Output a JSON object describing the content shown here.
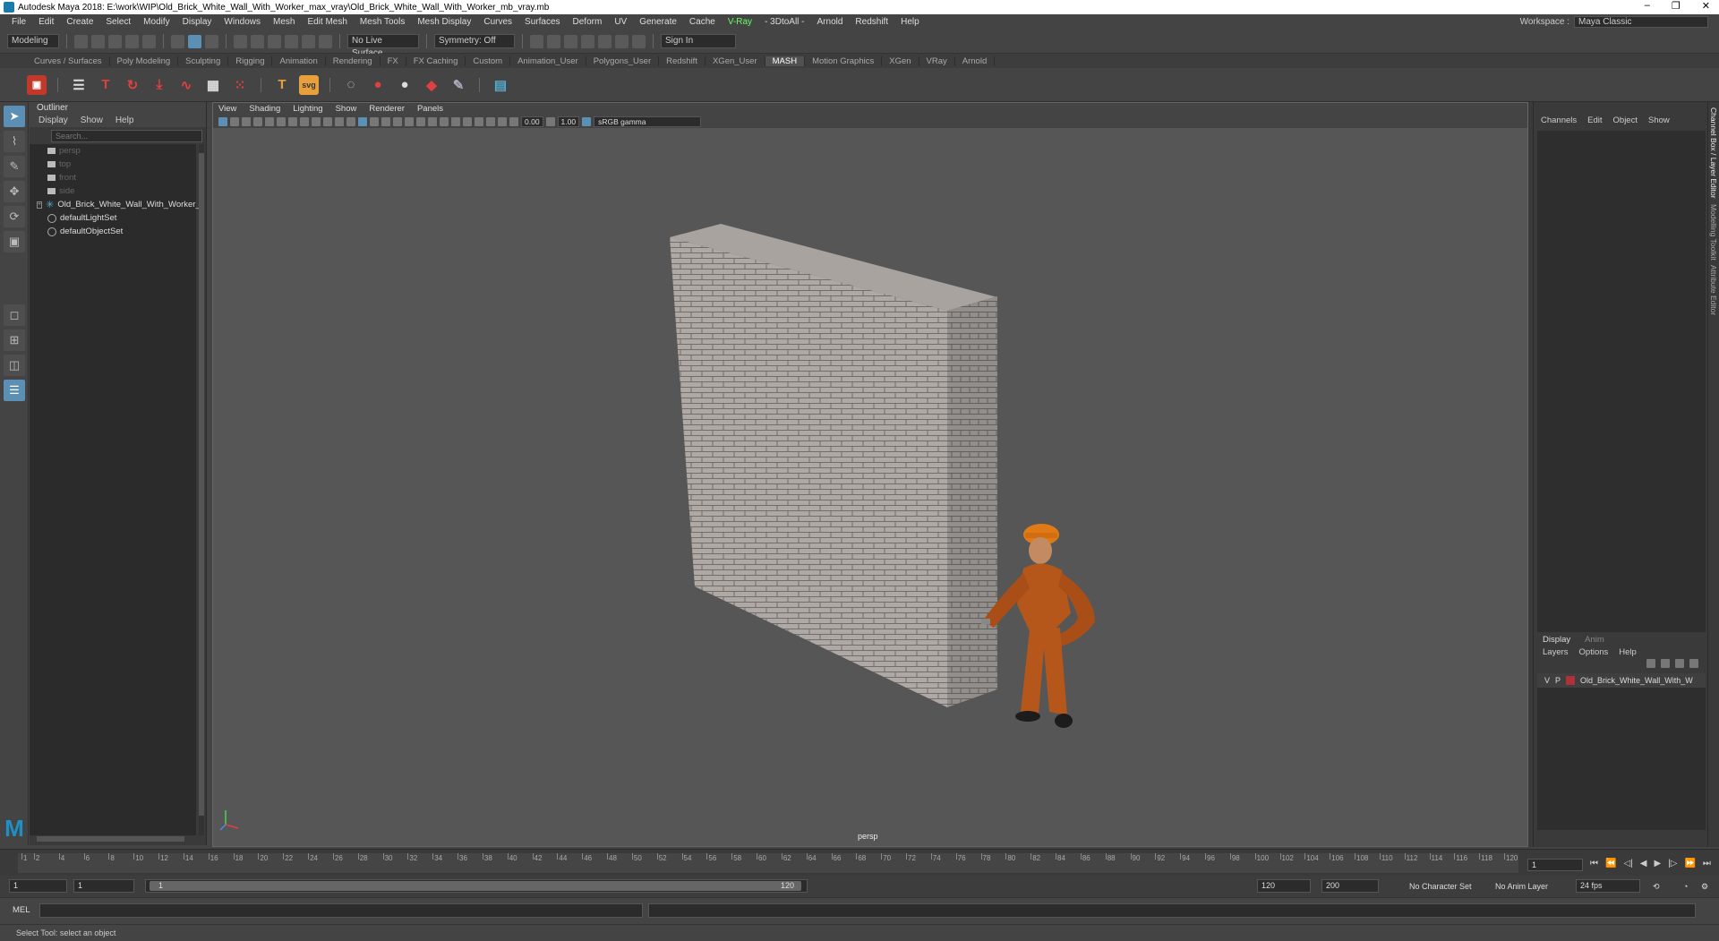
{
  "window": {
    "title": "Autodesk Maya 2018: E:\\work\\WIP\\Old_Brick_White_Wall_With_Worker_max_vray\\Old_Brick_White_Wall_With_Worker_mb_vray.mb",
    "minimize": "–",
    "restore": "❐",
    "close": "✕"
  },
  "menubar": [
    "File",
    "Edit",
    "Create",
    "Select",
    "Modify",
    "Display",
    "Windows",
    "Mesh",
    "Edit Mesh",
    "Mesh Tools",
    "Mesh Display",
    "Curves",
    "Surfaces",
    "Deform",
    "UV",
    "Generate",
    "Cache",
    "V-Ray",
    "- 3DtoAll -",
    "Arnold",
    "Redshift",
    "Help"
  ],
  "workspace": {
    "label": "Workspace :",
    "value": "Maya Classic"
  },
  "statusline": {
    "mode": "Modeling",
    "live_surface": "No Live Surface",
    "symmetry": "Symmetry: Off",
    "sign_in": "Sign In"
  },
  "shelf_tabs": [
    "Curves / Surfaces",
    "Poly Modeling",
    "Sculpting",
    "Rigging",
    "Animation",
    "Rendering",
    "FX",
    "FX Caching",
    "Custom",
    "Animation_User",
    "Polygons_User",
    "Redshift",
    "XGen_User",
    "MASH",
    "Motion Graphics",
    "XGen",
    "VRay",
    "Arnold"
  ],
  "shelf_active": "MASH",
  "outliner": {
    "title": "Outliner",
    "menu": [
      "Display",
      "Show",
      "Help"
    ],
    "search_placeholder": "Search...",
    "items": [
      {
        "label": "persp",
        "kind": "camera",
        "dim": true
      },
      {
        "label": "top",
        "kind": "camera",
        "dim": true
      },
      {
        "label": "front",
        "kind": "camera",
        "dim": true
      },
      {
        "label": "side",
        "kind": "camera",
        "dim": true
      },
      {
        "label": "Old_Brick_White_Wall_With_Worker_",
        "kind": "group",
        "dim": false
      },
      {
        "label": "defaultLightSet",
        "kind": "set",
        "dim": false
      },
      {
        "label": "defaultObjectSet",
        "kind": "set",
        "dim": false
      }
    ]
  },
  "viewport": {
    "menu": [
      "View",
      "Shading",
      "Lighting",
      "Show",
      "Renderer",
      "Panels"
    ],
    "exposure": "0.00",
    "gamma": "1.00",
    "color_space": "sRGB gamma",
    "camera": "persp"
  },
  "channelbox": {
    "menu": [
      "Channels",
      "Edit",
      "Object",
      "Show"
    ]
  },
  "layers": {
    "tabs": [
      "Display",
      "Anim"
    ],
    "active_tab": "Display",
    "menu": [
      "Layers",
      "Options",
      "Help"
    ],
    "rows": [
      {
        "v": "V",
        "p": "P",
        "name": "Old_Brick_White_Wall_With_W",
        "color": "#b0303a"
      }
    ]
  },
  "edge_tabs": [
    "Channel Box / Layer Editor",
    "Modelling Toolkit",
    "Attribute Editor"
  ],
  "timeline": {
    "ticks": [
      "1",
      "2",
      "4",
      "6",
      "8",
      "10",
      "12",
      "14",
      "16",
      "18",
      "20",
      "22",
      "24",
      "26",
      "28",
      "30",
      "32",
      "34",
      "36",
      "38",
      "40",
      "42",
      "44",
      "46",
      "48",
      "50",
      "52",
      "54",
      "56",
      "58",
      "60",
      "62",
      "64",
      "66",
      "68",
      "70",
      "72",
      "74",
      "76",
      "78",
      "80",
      "82",
      "84",
      "86",
      "88",
      "90",
      "92",
      "94",
      "96",
      "98",
      "100",
      "102",
      "104",
      "106",
      "108",
      "110",
      "112",
      "114",
      "116",
      "118",
      "120"
    ],
    "current_frame": "1"
  },
  "range": {
    "start": "1",
    "anim_start": "1",
    "range_start": "1",
    "range_end": "120",
    "playback_end": "120",
    "anim_end": "200",
    "character_set": "No Character Set",
    "anim_layer": "No Anim Layer",
    "fps": "24 fps"
  },
  "command": {
    "label": "MEL"
  },
  "help_line": "Select Tool: select an object"
}
